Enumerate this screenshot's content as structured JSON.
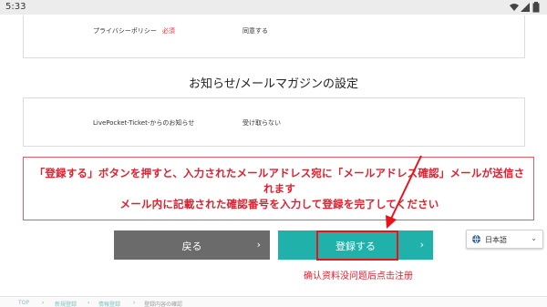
{
  "status_bar": {
    "time": "5:33"
  },
  "privacy": {
    "label": "プライバシーポリシー",
    "required": "必須",
    "value": "同意する"
  },
  "newsletter": {
    "section_title": "お知らせ/メールマガジンの設定",
    "label": "LivePocket-Ticket-からのお知らせ",
    "value": "受け取らない"
  },
  "notice": {
    "line1": "「登録する」ボタンを押すと、入力されたメールアドレス宛に「メールアドレス確認」メールが送信さ",
    "line2": "れます",
    "line3": "メール内に記載された確認番号を入力して登録を完了してください"
  },
  "buttons": {
    "back_label": "戻る",
    "register_label": "登録する",
    "chevron": "›"
  },
  "annotation": {
    "text": "确认资料没问题后点击注册"
  },
  "language": {
    "label": "日本語",
    "icon": "globe-icon"
  },
  "breadcrumb": {
    "items": [
      "TOP",
      "新規登録",
      "情報登録",
      "登録内容の確認"
    ],
    "separator": "›"
  },
  "colors": {
    "accent": "#20b2aa",
    "back": "#6b6b6b",
    "alert": "#e0202f"
  }
}
